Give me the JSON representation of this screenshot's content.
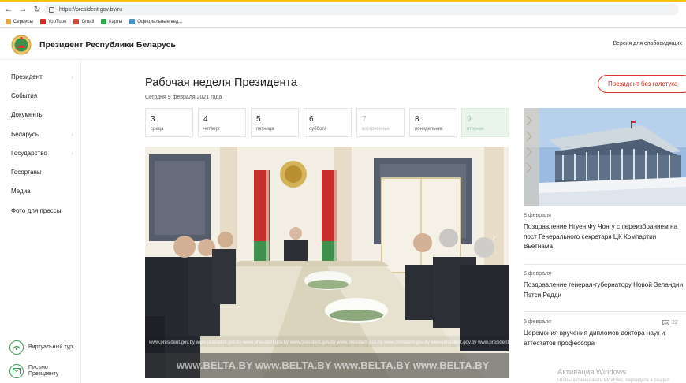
{
  "browser": {
    "url": "https://president.gov.by/ru",
    "bookmarks": [
      {
        "label": "Сервисы",
        "color": "#e8a33d"
      },
      {
        "label": "YouTube",
        "color": "#e02b20"
      },
      {
        "label": "Gmail",
        "color": "#d44638"
      },
      {
        "label": "Карты",
        "color": "#34a853"
      },
      {
        "label": "Официальные вед...",
        "color": "#4a90c2"
      }
    ]
  },
  "header": {
    "site_title": "Президент Республики Беларусь",
    "impaired_version": "Версия для слабовидящих"
  },
  "sidebar": {
    "items": [
      {
        "label": "Президент",
        "has_submenu": true
      },
      {
        "label": "События",
        "has_submenu": false
      },
      {
        "label": "Документы",
        "has_submenu": false
      },
      {
        "label": "Беларусь",
        "has_submenu": true
      },
      {
        "label": "Государство",
        "has_submenu": true
      },
      {
        "label": "Госорганы",
        "has_submenu": false
      },
      {
        "label": "Медиа",
        "has_submenu": false
      },
      {
        "label": "Фото для прессы",
        "has_submenu": false
      }
    ],
    "virtual_tour": "Виртуальный тур",
    "letter": "Письмо Президенту"
  },
  "main": {
    "title": "Рабочая неделя Президента",
    "date": "Сегодня 9 февраля 2021 года",
    "pill_button": "Президент без галстука",
    "days": [
      {
        "num": "3",
        "weekday": "среда",
        "state": "normal"
      },
      {
        "num": "4",
        "weekday": "четверг",
        "state": "normal"
      },
      {
        "num": "5",
        "weekday": "пятница",
        "state": "normal"
      },
      {
        "num": "6",
        "weekday": "суббота",
        "state": "normal"
      },
      {
        "num": "7",
        "weekday": "воскресенье",
        "state": "muted"
      },
      {
        "num": "8",
        "weekday": "понедельник",
        "state": "normal"
      },
      {
        "num": "9",
        "weekday": "вторник",
        "state": "today"
      }
    ],
    "photo_watermarks": [
      "www.president.gov.by",
      "www.BELTA.BY"
    ],
    "next_arrow": "›"
  },
  "news": [
    {
      "date": "8 февраля",
      "text": "Поздравление Нгуен Фу Чонгу с переизбранием на пост Генерального секретаря ЦК Компартии Вьетнама"
    },
    {
      "date": "6 февраля",
      "text": "Поздравление генерал-губернатору Новой Зеландии Пэтси Редди"
    },
    {
      "date": "5 февраля",
      "text": "Церемония вручения дипломов доктора наук и аттестатов профессора",
      "photo_count": "22"
    }
  ],
  "windows": {
    "activation": "Активация Windows",
    "activation_sub": "Чтобы активировать Windows, перейдите в раздел"
  },
  "colors": {
    "accent_red": "#d9382e",
    "today_green": "#e9f5ea",
    "sidebar_green": "#3f9c5a"
  }
}
